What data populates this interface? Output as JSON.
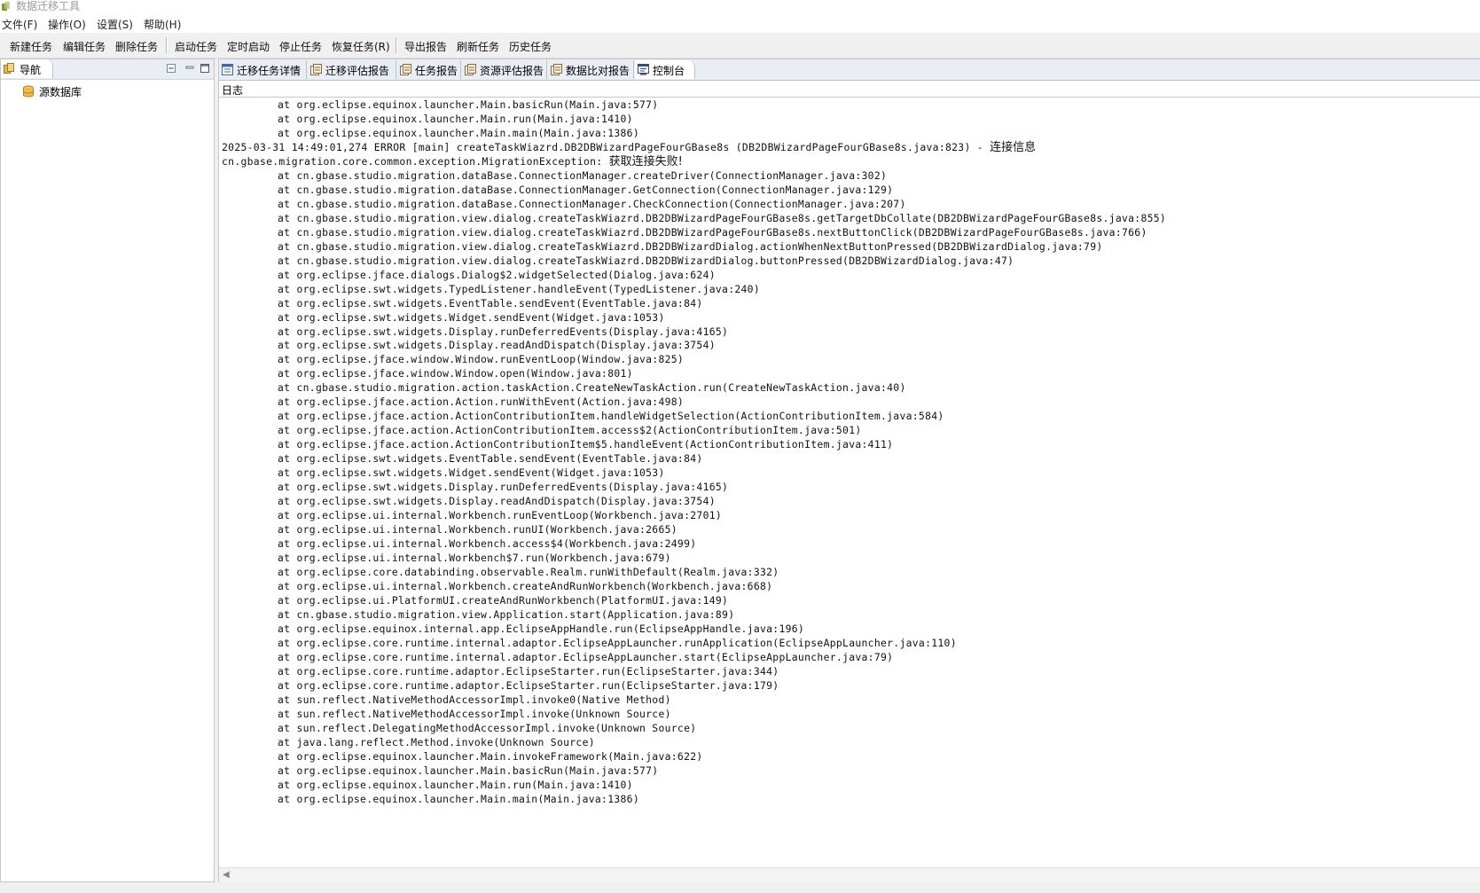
{
  "window": {
    "title": "数据迁移工具"
  },
  "menu": [
    "文件(F)",
    "操作(O)",
    "设置(S)",
    "帮助(H)"
  ],
  "toolbar": {
    "group1": [
      "新建任务",
      "编辑任务",
      "删除任务"
    ],
    "group2": [
      "启动任务",
      "定时启动",
      "停止任务",
      "恢复任务(R)"
    ],
    "group3": [
      "导出报告",
      "刷新任务",
      "历史任务"
    ]
  },
  "nav": {
    "tab_label": "导航",
    "tree": [
      {
        "label": "源数据库"
      }
    ]
  },
  "editor": {
    "tabs": [
      {
        "label": "迁移任务详情",
        "active": false
      },
      {
        "label": "迁移评估报告",
        "active": false
      },
      {
        "label": "任务报告",
        "active": false
      },
      {
        "label": "资源评估报告",
        "active": false
      },
      {
        "label": "数据比对报告",
        "active": false
      },
      {
        "label": "控制台",
        "active": true
      }
    ],
    "console_label": "日志"
  },
  "log": [
    {
      "indent": true,
      "text": "at org.eclipse.equinox.launcher.Main.basicRun(Main.java:577)"
    },
    {
      "indent": true,
      "text": "at org.eclipse.equinox.launcher.Main.run(Main.java:1410)"
    },
    {
      "indent": true,
      "text": "at org.eclipse.equinox.launcher.Main.main(Main.java:1386)"
    },
    {
      "indent": false,
      "text": "2025-03-31 14:49:01,274 ERROR [main] createTaskWiazrd.DB2DBWizardPageFourGBase8s (DB2DBWizardPageFourGBase8s.java:823) - ",
      "cjk": "连接信息"
    },
    {
      "indent": false,
      "text": "cn.gbase.migration.core.common.exception.MigrationException: ",
      "cjk": "获取连接失败!"
    },
    {
      "indent": true,
      "text": "at cn.gbase.studio.migration.dataBase.ConnectionManager.createDriver(ConnectionManager.java:302)"
    },
    {
      "indent": true,
      "text": "at cn.gbase.studio.migration.dataBase.ConnectionManager.GetConnection(ConnectionManager.java:129)"
    },
    {
      "indent": true,
      "text": "at cn.gbase.studio.migration.dataBase.ConnectionManager.CheckConnection(ConnectionManager.java:207)"
    },
    {
      "indent": true,
      "text": "at cn.gbase.studio.migration.view.dialog.createTaskWiazrd.DB2DBWizardPageFourGBase8s.getTargetDbCollate(DB2DBWizardPageFourGBase8s.java:855)"
    },
    {
      "indent": true,
      "text": "at cn.gbase.studio.migration.view.dialog.createTaskWiazrd.DB2DBWizardPageFourGBase8s.nextButtonClick(DB2DBWizardPageFourGBase8s.java:766)"
    },
    {
      "indent": true,
      "text": "at cn.gbase.studio.migration.view.dialog.createTaskWiazrd.DB2DBWizardDialog.actionWhenNextButtonPressed(DB2DBWizardDialog.java:79)"
    },
    {
      "indent": true,
      "text": "at cn.gbase.studio.migration.view.dialog.createTaskWiazrd.DB2DBWizardDialog.buttonPressed(DB2DBWizardDialog.java:47)"
    },
    {
      "indent": true,
      "text": "at org.eclipse.jface.dialogs.Dialog$2.widgetSelected(Dialog.java:624)"
    },
    {
      "indent": true,
      "text": "at org.eclipse.swt.widgets.TypedListener.handleEvent(TypedListener.java:240)"
    },
    {
      "indent": true,
      "text": "at org.eclipse.swt.widgets.EventTable.sendEvent(EventTable.java:84)"
    },
    {
      "indent": true,
      "text": "at org.eclipse.swt.widgets.Widget.sendEvent(Widget.java:1053)"
    },
    {
      "indent": true,
      "text": "at org.eclipse.swt.widgets.Display.runDeferredEvents(Display.java:4165)"
    },
    {
      "indent": true,
      "text": "at org.eclipse.swt.widgets.Display.readAndDispatch(Display.java:3754)"
    },
    {
      "indent": true,
      "text": "at org.eclipse.jface.window.Window.runEventLoop(Window.java:825)"
    },
    {
      "indent": true,
      "text": "at org.eclipse.jface.window.Window.open(Window.java:801)"
    },
    {
      "indent": true,
      "text": "at cn.gbase.studio.migration.action.taskAction.CreateNewTaskAction.run(CreateNewTaskAction.java:40)"
    },
    {
      "indent": true,
      "text": "at org.eclipse.jface.action.Action.runWithEvent(Action.java:498)"
    },
    {
      "indent": true,
      "text": "at org.eclipse.jface.action.ActionContributionItem.handleWidgetSelection(ActionContributionItem.java:584)"
    },
    {
      "indent": true,
      "text": "at org.eclipse.jface.action.ActionContributionItem.access$2(ActionContributionItem.java:501)"
    },
    {
      "indent": true,
      "text": "at org.eclipse.jface.action.ActionContributionItem$5.handleEvent(ActionContributionItem.java:411)"
    },
    {
      "indent": true,
      "text": "at org.eclipse.swt.widgets.EventTable.sendEvent(EventTable.java:84)"
    },
    {
      "indent": true,
      "text": "at org.eclipse.swt.widgets.Widget.sendEvent(Widget.java:1053)"
    },
    {
      "indent": true,
      "text": "at org.eclipse.swt.widgets.Display.runDeferredEvents(Display.java:4165)"
    },
    {
      "indent": true,
      "text": "at org.eclipse.swt.widgets.Display.readAndDispatch(Display.java:3754)"
    },
    {
      "indent": true,
      "text": "at org.eclipse.ui.internal.Workbench.runEventLoop(Workbench.java:2701)"
    },
    {
      "indent": true,
      "text": "at org.eclipse.ui.internal.Workbench.runUI(Workbench.java:2665)"
    },
    {
      "indent": true,
      "text": "at org.eclipse.ui.internal.Workbench.access$4(Workbench.java:2499)"
    },
    {
      "indent": true,
      "text": "at org.eclipse.ui.internal.Workbench$7.run(Workbench.java:679)"
    },
    {
      "indent": true,
      "text": "at org.eclipse.core.databinding.observable.Realm.runWithDefault(Realm.java:332)"
    },
    {
      "indent": true,
      "text": "at org.eclipse.ui.internal.Workbench.createAndRunWorkbench(Workbench.java:668)"
    },
    {
      "indent": true,
      "text": "at org.eclipse.ui.PlatformUI.createAndRunWorkbench(PlatformUI.java:149)"
    },
    {
      "indent": true,
      "text": "at cn.gbase.studio.migration.view.Application.start(Application.java:89)"
    },
    {
      "indent": true,
      "text": "at org.eclipse.equinox.internal.app.EclipseAppHandle.run(EclipseAppHandle.java:196)"
    },
    {
      "indent": true,
      "text": "at org.eclipse.core.runtime.internal.adaptor.EclipseAppLauncher.runApplication(EclipseAppLauncher.java:110)"
    },
    {
      "indent": true,
      "text": "at org.eclipse.core.runtime.internal.adaptor.EclipseAppLauncher.start(EclipseAppLauncher.java:79)"
    },
    {
      "indent": true,
      "text": "at org.eclipse.core.runtime.adaptor.EclipseStarter.run(EclipseStarter.java:344)"
    },
    {
      "indent": true,
      "text": "at org.eclipse.core.runtime.adaptor.EclipseStarter.run(EclipseStarter.java:179)"
    },
    {
      "indent": true,
      "text": "at sun.reflect.NativeMethodAccessorImpl.invoke0(Native Method)"
    },
    {
      "indent": true,
      "text": "at sun.reflect.NativeMethodAccessorImpl.invoke(Unknown Source)"
    },
    {
      "indent": true,
      "text": "at sun.reflect.DelegatingMethodAccessorImpl.invoke(Unknown Source)"
    },
    {
      "indent": true,
      "text": "at java.lang.reflect.Method.invoke(Unknown Source)"
    },
    {
      "indent": true,
      "text": "at org.eclipse.equinox.launcher.Main.invokeFramework(Main.java:622)"
    },
    {
      "indent": true,
      "text": "at org.eclipse.equinox.launcher.Main.basicRun(Main.java:577)"
    },
    {
      "indent": true,
      "text": "at org.eclipse.equinox.launcher.Main.run(Main.java:1410)"
    },
    {
      "indent": true,
      "text": "at org.eclipse.equinox.launcher.Main.main(Main.java:1386)"
    }
  ]
}
